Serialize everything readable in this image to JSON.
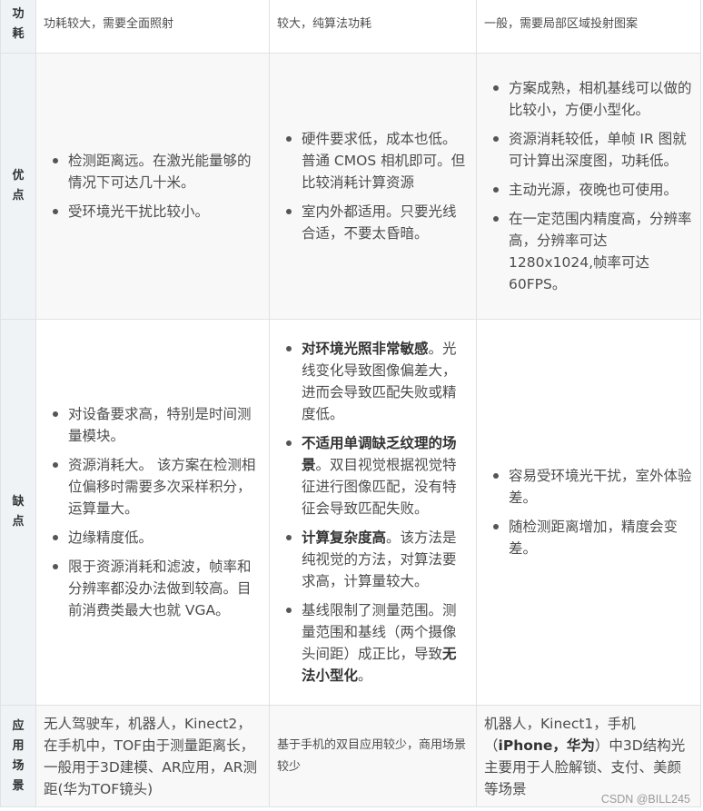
{
  "rows": {
    "power": {
      "label_chars": [
        "功",
        "耗"
      ],
      "col1": "功耗较大，需要全面照射",
      "col2": "较大，纯算法功耗",
      "col3": "一般，需要局部区域投射图案"
    },
    "advantages": {
      "label_chars": [
        "优",
        "点"
      ],
      "col1": [
        "检测距离远。在激光能量够的情况下可达几十米。",
        "受环境光干扰比较小。"
      ],
      "col2": [
        "硬件要求低，成本也低。普通 CMOS 相机即可。但比较消耗计算资源",
        "室内外都适用。只要光线合适，不要太昏暗。"
      ],
      "col3": [
        "方案成熟，相机基线可以做的比较小，方便小型化。",
        "资源消耗较低，单帧 IR 图就可计算出深度图，功耗低。",
        "主动光源，夜晚也可使用。",
        "在一定范围内精度高，分辨率高，分辨率可达 1280x1024,帧率可达 60FPS。"
      ]
    },
    "disadvantages": {
      "label_chars": [
        "缺",
        "点"
      ],
      "col1": [
        "对设备要求高，特别是时间测量模块。",
        "资源消耗大。 该方案在检测相位偏移时需要多次采样积分，运算量大。",
        "边缘精度低。",
        "限于资源消耗和滤波，帧率和分辨率都没办法做到较高。目前消费类最大也就 VGA。"
      ],
      "col2": [
        {
          "bold": "对环境光照非常敏感",
          "text": "。光线变化导致图像偏差大，进而会导致匹配失败或精度低。"
        },
        {
          "bold": "不适用单调缺乏纹理的场景",
          "text": "。双目视觉根据视觉特征进行图像匹配，没有特征会导致匹配失败。"
        },
        {
          "bold": "计算复杂度高",
          "text": "。该方法是纯视觉的方法，对算法要求高，计算量较大。"
        },
        {
          "pre": "基线限制了测量范围。测量范围和基线（两个摄像头间距）成正比，导致",
          "bold": "无法小型化",
          "text": "。"
        }
      ],
      "col3": [
        "容易受环境光干扰，室外体验差。",
        "随检测距离增加，精度会变差。"
      ]
    },
    "applications": {
      "label_chars": [
        "应",
        "用",
        "场",
        "景"
      ],
      "col1": "无人驾驶车，机器人，Kinect2，在手机中，TOF由于测量距离长，一般用于3D建模、AR应用，AR测距(华为TOF镜头)",
      "col2": "基于手机的双目应用较少，商用场景较少",
      "col3_pre": "机器人，Kinect1，手机（",
      "col3_bold": "iPhone，华为",
      "col3_post": "）中3D结构光主要用于人脸解锁、支付、美颜等场景"
    }
  },
  "watermark": "CSDN @BILL245"
}
